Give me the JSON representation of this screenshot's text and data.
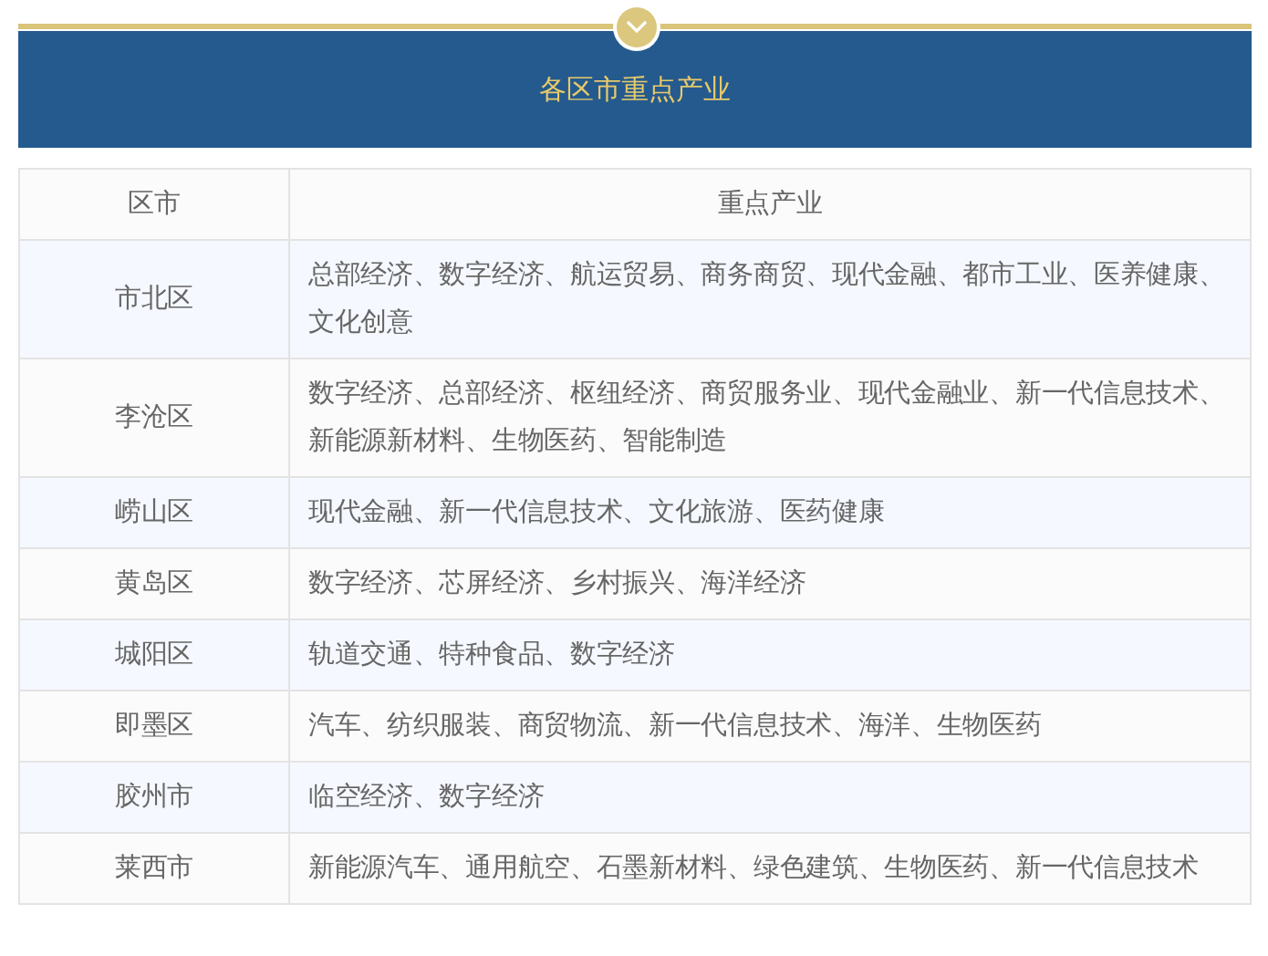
{
  "title": "各区市重点产业",
  "table": {
    "columns": [
      "区市",
      "重点产业"
    ],
    "rows": [
      {
        "district": "市北区",
        "industries": "总部经济、数字经济、航运贸易、商务商贸、现代金融、都市工业、医养健康、文化创意"
      },
      {
        "district": "李沧区",
        "industries": "数字经济、总部经济、枢纽经济、商贸服务业、现代金融业、新一代信息技术、新能源新材料、生物医药、智能制造"
      },
      {
        "district": "崂山区",
        "industries": "现代金融、新一代信息技术、文化旅游、医药健康"
      },
      {
        "district": "黄岛区",
        "industries": "数字经济、芯屏经济、乡村振兴、海洋经济"
      },
      {
        "district": "城阳区",
        "industries": "轨道交通、特种食品、数字经济"
      },
      {
        "district": "即墨区",
        "industries": "汽车、纺织服装、商贸物流、新一代信息技术、海洋、生物医药"
      },
      {
        "district": "胶州市",
        "industries": "临空经济、数字经济"
      },
      {
        "district": "莱西市",
        "industries": "新能源汽车、通用航空、石墨新材料、绿色建筑、生物医药、新一代信息技术"
      }
    ]
  }
}
